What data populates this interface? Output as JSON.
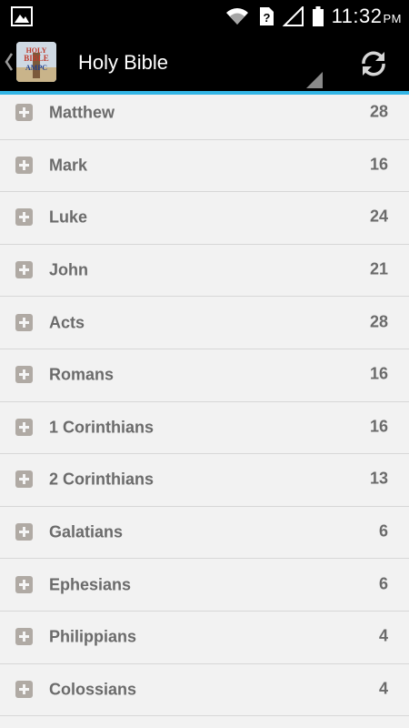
{
  "status_bar": {
    "time": "11:32",
    "ampm": "PM",
    "icons": [
      "gallery-icon",
      "wifi-icon",
      "unknown-sim-icon",
      "signal-icon",
      "battery-icon"
    ]
  },
  "action_bar": {
    "title": "Holy Bible",
    "app_icon_text": [
      "HOLY",
      "BIBLE",
      "AMPC"
    ],
    "accent_color": "#33b5e5",
    "refresh_icon": "refresh-icon"
  },
  "books": [
    {
      "name": "Matthew",
      "chapters": "28"
    },
    {
      "name": "Mark",
      "chapters": "16"
    },
    {
      "name": "Luke",
      "chapters": "24"
    },
    {
      "name": "John",
      "chapters": "21"
    },
    {
      "name": "Acts",
      "chapters": "28"
    },
    {
      "name": "Romans",
      "chapters": "16"
    },
    {
      "name": "1 Corinthians",
      "chapters": "16"
    },
    {
      "name": "2 Corinthians",
      "chapters": "13"
    },
    {
      "name": "Galatians",
      "chapters": "6"
    },
    {
      "name": "Ephesians",
      "chapters": "6"
    },
    {
      "name": "Philippians",
      "chapters": "4"
    },
    {
      "name": "Colossians",
      "chapters": "4"
    }
  ]
}
